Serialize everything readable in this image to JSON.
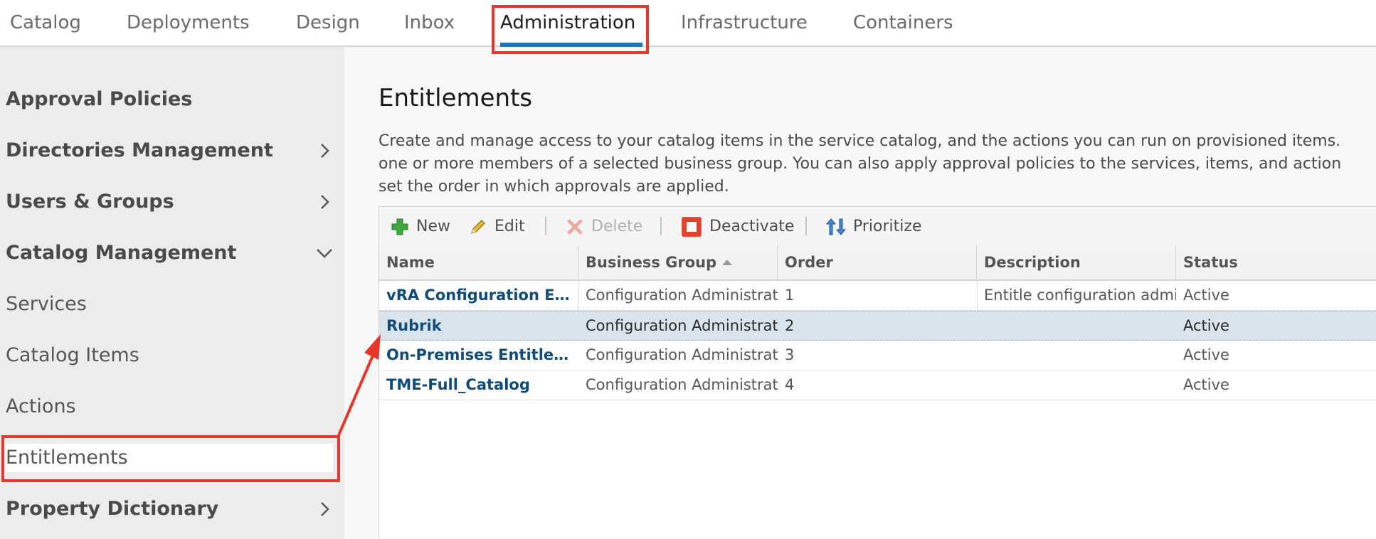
{
  "topnav": {
    "tabs": [
      {
        "label": "Catalog"
      },
      {
        "label": "Deployments"
      },
      {
        "label": "Design"
      },
      {
        "label": "Inbox"
      },
      {
        "label": "Administration",
        "active": true
      },
      {
        "label": "Infrastructure"
      },
      {
        "label": "Containers"
      }
    ]
  },
  "sidebar": {
    "items": [
      {
        "label": "Approval Policies",
        "type": "header",
        "chevron": "none"
      },
      {
        "label": "Directories Management",
        "type": "header",
        "chevron": "right"
      },
      {
        "label": "Users & Groups",
        "type": "header",
        "chevron": "right"
      },
      {
        "label": "Catalog Management",
        "type": "header",
        "chevron": "down"
      },
      {
        "label": "Services",
        "type": "sub"
      },
      {
        "label": "Catalog Items",
        "type": "sub"
      },
      {
        "label": "Actions",
        "type": "sub"
      },
      {
        "label": "Entitlements",
        "type": "sub",
        "selected": true
      },
      {
        "label": "Property Dictionary",
        "type": "header",
        "chevron": "right"
      }
    ]
  },
  "main": {
    "title": "Entitlements",
    "description_lines": [
      "Create and manage access to your catalog items in the service catalog, and the actions you can run on provisioned items.",
      "one or more members of a selected business group. You can also apply approval policies to the services, items, and action",
      "set the order in which approvals are applied."
    ],
    "toolbar": {
      "new": "New",
      "edit": "Edit",
      "delete": "Delete",
      "deactivate": "Deactivate",
      "prioritize": "Prioritize"
    },
    "table": {
      "columns": [
        "Name",
        "Business Group",
        "Order",
        "Description",
        "Status"
      ],
      "sorted_column": "Business Group",
      "sort_direction": "ascending",
      "rows": [
        {
          "name": "vRA Configuration Enti...",
          "business_group": "Configuration Administrat",
          "order": "1",
          "description": "Entitle configuration admi",
          "status": "Active"
        },
        {
          "name": "Rubrik",
          "business_group": "Configuration Administrat",
          "order": "2",
          "description": "",
          "status": "Active",
          "selected": true
        },
        {
          "name": "On-Premises Entitleme...",
          "business_group": "Configuration Administrat",
          "order": "3",
          "description": "",
          "status": "Active"
        },
        {
          "name": "TME-Full_Catalog",
          "business_group": "Configuration Administrat",
          "order": "4",
          "description": "",
          "status": "Active"
        }
      ]
    }
  },
  "colors": {
    "accent": "#1a73bd",
    "annotation": "#e8362c",
    "link": "#0e4c7e",
    "selected_row": "#d9e4ec",
    "sidebar_bg": "#ececec"
  },
  "icons": {
    "new": "plus-icon",
    "edit": "pencil-icon",
    "delete": "x-icon",
    "deactivate": "stop-icon",
    "prioritize": "prioritize-arrows-icon",
    "sort": "sort-ascending-icon",
    "expand": "chevron-right-icon",
    "collapse": "chevron-down-icon"
  }
}
